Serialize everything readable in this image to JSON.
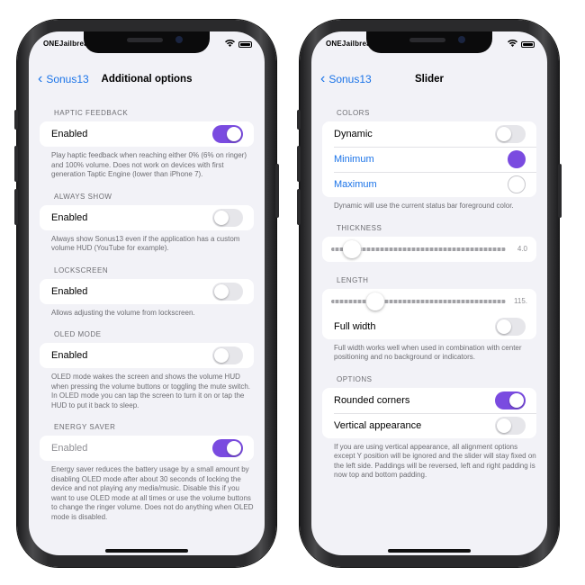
{
  "colors": {
    "accent": "#7a4be0",
    "link": "#1a73e8",
    "background": "#f2f2f7"
  },
  "left": {
    "status": {
      "carrier": "ONEJailbreak"
    },
    "nav": {
      "back_label": "Sonus13",
      "title": "Additional options"
    },
    "sections": [
      {
        "header": "HAPTIC FEEDBACK",
        "row_label": "Enabled",
        "toggle_on": true,
        "dim": false,
        "footer": "Play haptic feedback when reaching either 0% (6% on ringer) and 100% volume. Does not work on devices with first generation Taptic Engine (lower than iPhone 7)."
      },
      {
        "header": "ALWAYS SHOW",
        "row_label": "Enabled",
        "toggle_on": false,
        "dim": false,
        "footer": "Always show Sonus13 even if the application has a custom volume HUD (YouTube for example)."
      },
      {
        "header": "LOCKSCREEN",
        "row_label": "Enabled",
        "toggle_on": false,
        "dim": false,
        "footer": "Allows adjusting the volume from lockscreen."
      },
      {
        "header": "OLED MODE",
        "row_label": "Enabled",
        "toggle_on": false,
        "dim": false,
        "footer": "OLED mode wakes the screen and shows the volume HUD when pressing the volume buttons or toggling the mute switch. In OLED mode you can tap the screen to turn it on or tap the HUD to put it back to sleep."
      },
      {
        "header": "ENERGY SAVER",
        "row_label": "Enabled",
        "toggle_on": true,
        "dim": true,
        "footer": "Energy saver reduces the battery usage by a small amount by disabling OLED mode after about 30 seconds of locking the device and not playing any media/music. Disable this if you want to use OLED mode at all times or use the volume buttons to change the ringer volume. Does not do anything when OLED mode is disabled."
      }
    ]
  },
  "right": {
    "status": {
      "carrier": "ONEJailbreak"
    },
    "nav": {
      "back_label": "Sonus13",
      "title": "Slider"
    },
    "colors_section": {
      "header": "COLORS",
      "items": [
        {
          "label": "Dynamic",
          "control": "toggle-off"
        },
        {
          "label": "Minimum",
          "control": "swatch",
          "swatch_color": "#7a4be0"
        },
        {
          "label": "Maximum",
          "control": "swatch",
          "swatch_color": "#ffffff"
        }
      ],
      "footer": "Dynamic will use the current status bar foreground color."
    },
    "thickness": {
      "header": "THICKNESS",
      "value_label": "4.0",
      "fraction": 0.12
    },
    "length": {
      "header": "LENGTH",
      "value_label": "115.",
      "fraction": 0.25,
      "full_width_label": "Full width",
      "full_width_on": false,
      "footer": "Full width works well when used in combination with center positioning and no background or indicators."
    },
    "options": {
      "header": "OPTIONS",
      "rounded_label": "Rounded corners",
      "rounded_on": true,
      "vertical_label": "Vertical appearance",
      "vertical_on": false,
      "footer": "If you are using vertical appearance, all alignment options except Y position will be ignored and the slider will stay fixed on the left side. Paddings will be reversed, left and right padding is now top and bottom padding."
    }
  }
}
